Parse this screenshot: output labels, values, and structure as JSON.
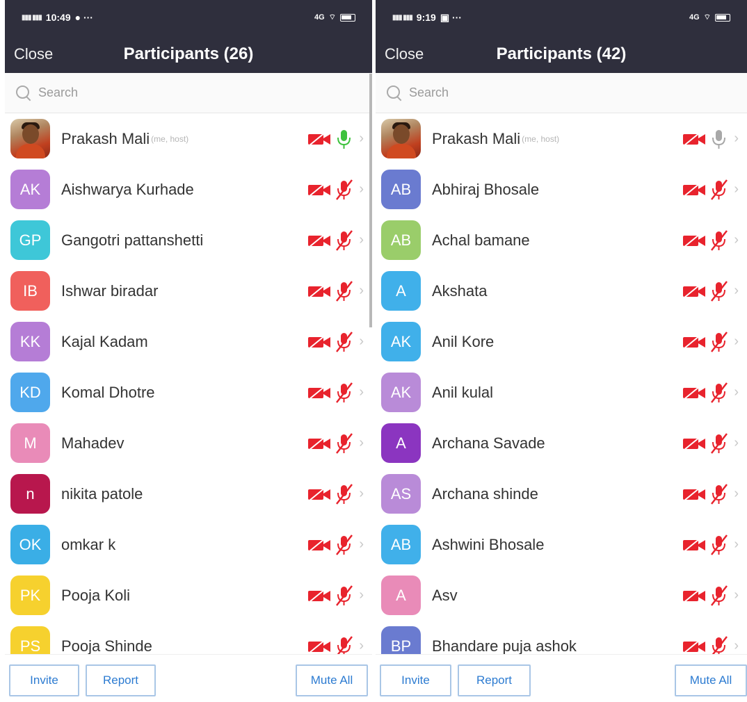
{
  "screens": [
    {
      "status": {
        "time": "10:49",
        "signal": "4G"
      },
      "close_label": "Close",
      "title": "Participants (26)",
      "search_placeholder": "Search",
      "participants": [
        {
          "name": "Prakash Mali",
          "tag": "(me, host)",
          "initials": "",
          "color": "#c64a20",
          "photo": true,
          "mic": "on"
        },
        {
          "name": "Aishwarya Kurhade",
          "initials": "AK",
          "color": "#b57dd6",
          "mic": "muted"
        },
        {
          "name": "Gangotri pattanshetti",
          "initials": "GP",
          "color": "#3ec7d8",
          "mic": "muted"
        },
        {
          "name": "Ishwar biradar",
          "initials": "IB",
          "color": "#f0605c",
          "mic": "muted"
        },
        {
          "name": "Kajal Kadam",
          "initials": "KK",
          "color": "#b57dd6",
          "mic": "muted"
        },
        {
          "name": "Komal Dhotre",
          "initials": "KD",
          "color": "#4fa8ec",
          "mic": "muted"
        },
        {
          "name": "Mahadev",
          "initials": "M",
          "color": "#e98bb8",
          "mic": "muted"
        },
        {
          "name": "nikita patole",
          "initials": "n",
          "color": "#b8174d",
          "mic": "muted"
        },
        {
          "name": "omkar k",
          "initials": "OK",
          "color": "#3aaee6",
          "mic": "muted"
        },
        {
          "name": "Pooja Koli",
          "initials": "PK",
          "color": "#f6d12e",
          "mic": "muted"
        },
        {
          "name": "Pooja Shinde",
          "initials": "PS",
          "color": "#f6d12e",
          "mic": "muted"
        }
      ],
      "buttons": {
        "invite": "Invite",
        "report": "Report",
        "mute_all": "Mute All"
      }
    },
    {
      "status": {
        "time": "9:19",
        "signal": "4G"
      },
      "close_label": "Close",
      "title": "Participants (42)",
      "search_placeholder": "Search",
      "participants": [
        {
          "name": "Prakash Mali",
          "tag": "(me, host)",
          "initials": "",
          "color": "#c64a20",
          "photo": true,
          "mic": "idle"
        },
        {
          "name": "Abhiraj Bhosale",
          "initials": "AB",
          "color": "#6a7bd0",
          "mic": "muted"
        },
        {
          "name": "Achal bamane",
          "initials": "AB",
          "color": "#9acd6a",
          "mic": "muted"
        },
        {
          "name": "Akshata",
          "initials": "A",
          "color": "#40b0ea",
          "mic": "muted"
        },
        {
          "name": "Anil Kore",
          "initials": "AK",
          "color": "#40b0ea",
          "mic": "muted"
        },
        {
          "name": "Anil kulal",
          "initials": "AK",
          "color": "#b98bd8",
          "mic": "muted"
        },
        {
          "name": "Archana Savade",
          "initials": "A",
          "color": "#8b35c0",
          "mic": "muted"
        },
        {
          "name": "Archana shinde",
          "initials": "AS",
          "color": "#b98bd8",
          "mic": "muted"
        },
        {
          "name": "Ashwini Bhosale",
          "initials": "AB",
          "color": "#40b0ea",
          "mic": "muted"
        },
        {
          "name": "Asv",
          "initials": "A",
          "color": "#e98bb8",
          "mic": "muted"
        },
        {
          "name": "Bhandare puja ashok",
          "initials": "BP",
          "color": "#6a7bd0",
          "mic": "muted"
        }
      ],
      "buttons": {
        "invite": "Invite",
        "report": "Report",
        "mute_all": "Mute All"
      }
    }
  ],
  "colors": {
    "header_bg": "#2f2f3d",
    "muted_red": "#e8232d",
    "mic_on_green": "#3ec23e",
    "button_text": "#2c7bd1"
  }
}
